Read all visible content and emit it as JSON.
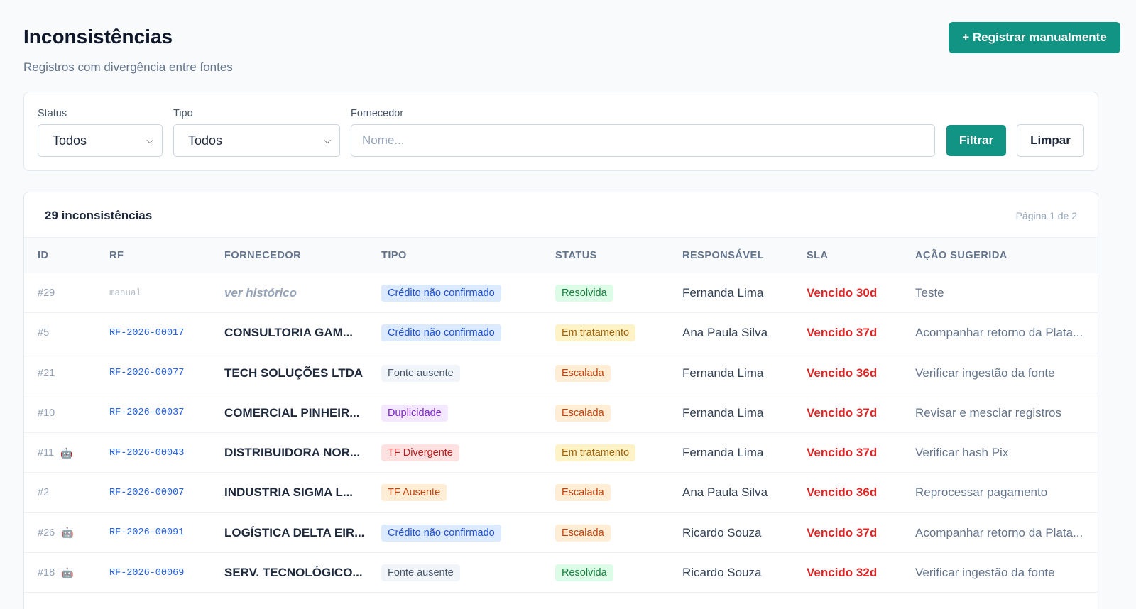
{
  "header": {
    "title": "Inconsistências",
    "subtitle": "Registros com divergência entre fontes",
    "register_button": "+ Registrar manualmente"
  },
  "filters": {
    "status_label": "Status",
    "status_value": "Todos",
    "tipo_label": "Tipo",
    "tipo_value": "Todos",
    "fornecedor_label": "Fornecedor",
    "fornecedor_placeholder": "Nome...",
    "filter_button": "Filtrar",
    "clear_button": "Limpar"
  },
  "table": {
    "count_label": "29 inconsistências",
    "pagination": "Página 1 de 2",
    "columns": [
      "ID",
      "RF",
      "FORNECEDOR",
      "TIPO",
      "STATUS",
      "RESPONSÁVEL",
      "SLA",
      "AÇÃO SUGERIDA"
    ],
    "rows": [
      {
        "id": "#29",
        "bot": false,
        "rf": "manual",
        "fornecedor": "ver histórico",
        "tipo": "Crédito não confirmado",
        "tipo_kind": "blue",
        "status": "Resolvida",
        "status_kind": "green",
        "responsavel": "Fernanda Lima",
        "sla": "Vencido 30d",
        "acao": "Teste"
      },
      {
        "id": "#5",
        "bot": false,
        "rf": "RF-2026-00017",
        "fornecedor": "CONSULTORIA GAM...",
        "tipo": "Crédito não confirmado",
        "tipo_kind": "blue",
        "status": "Em tratamento",
        "status_kind": "yellow",
        "responsavel": "Ana Paula Silva",
        "sla": "Vencido 37d",
        "acao": "Acompanhar retorno da Plata..."
      },
      {
        "id": "#21",
        "bot": false,
        "rf": "RF-2026-00077",
        "fornecedor": "TECH SOLUÇÕES LTDA",
        "tipo": "Fonte ausente",
        "tipo_kind": "gray",
        "status": "Escalada",
        "status_kind": "orange",
        "responsavel": "Fernanda Lima",
        "sla": "Vencido 36d",
        "acao": "Verificar ingestão da fonte"
      },
      {
        "id": "#10",
        "bot": false,
        "rf": "RF-2026-00037",
        "fornecedor": "COMERCIAL PINHEIR...",
        "tipo": "Duplicidade",
        "tipo_kind": "purple",
        "status": "Escalada",
        "status_kind": "orange",
        "responsavel": "Fernanda Lima",
        "sla": "Vencido 37d",
        "acao": "Revisar e mesclar registros"
      },
      {
        "id": "#11",
        "bot": true,
        "rf": "RF-2026-00043",
        "fornecedor": "DISTRIBUIDORA NOR...",
        "tipo": "TF Divergente",
        "tipo_kind": "red",
        "status": "Em tratamento",
        "status_kind": "yellow",
        "responsavel": "Fernanda Lima",
        "sla": "Vencido 37d",
        "acao": "Verificar hash Pix"
      },
      {
        "id": "#2",
        "bot": false,
        "rf": "RF-2026-00007",
        "fornecedor": "INDUSTRIA SIGMA L...",
        "tipo": "TF Ausente",
        "tipo_kind": "orange",
        "status": "Escalada",
        "status_kind": "orange",
        "responsavel": "Ana Paula Silva",
        "sla": "Vencido 36d",
        "acao": "Reprocessar pagamento"
      },
      {
        "id": "#26",
        "bot": true,
        "rf": "RF-2026-00091",
        "fornecedor": "LOGÍSTICA DELTA EIR...",
        "tipo": "Crédito não confirmado",
        "tipo_kind": "blue",
        "status": "Escalada",
        "status_kind": "orange",
        "responsavel": "Ricardo Souza",
        "sla": "Vencido 37d",
        "acao": "Acompanhar retorno da Plata..."
      },
      {
        "id": "#18",
        "bot": true,
        "rf": "RF-2026-00069",
        "fornecedor": "SERV. TECNOLÓGICO...",
        "tipo": "Fonte ausente",
        "tipo_kind": "gray",
        "status": "Resolvida",
        "status_kind": "green",
        "responsavel": "Ricardo Souza",
        "sla": "Vencido 32d",
        "acao": "Verificar ingestão da fonte"
      },
      {
        "id": "",
        "bot": false,
        "rf": "",
        "fornecedor": "",
        "tipo": "",
        "tipo_kind": "gray",
        "status": "",
        "status_kind": "gray",
        "responsavel": "",
        "sla": "",
        "acao": ""
      }
    ]
  },
  "colors": {
    "accent": "#129485",
    "sla_overdue": "#dc2626",
    "badge_blue": [
      "#dbeafe",
      "#1d4ed8"
    ],
    "badge_gray": [
      "#f1f5f9",
      "#475569"
    ],
    "badge_purple": [
      "#f3e8ff",
      "#7e22ce"
    ],
    "badge_red": [
      "#fee2e2",
      "#b91c1c"
    ],
    "badge_orange": [
      "#ffedd5",
      "#c2410c"
    ],
    "badge_green": [
      "#dcfce7",
      "#15803d"
    ],
    "badge_yellow": [
      "#fef3c7",
      "#a16207"
    ]
  },
  "icons": {
    "bot": "robot-icon",
    "select_chevron": "chevron-down-icon"
  }
}
